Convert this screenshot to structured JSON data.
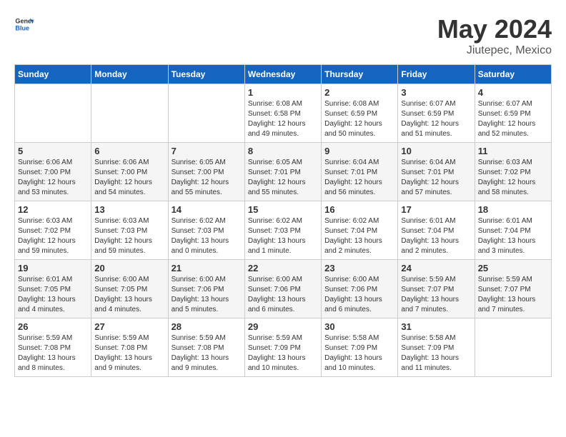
{
  "header": {
    "logo_general": "General",
    "logo_blue": "Blue",
    "title": "May 2024",
    "subtitle": "Jiutepec, Mexico"
  },
  "days_of_week": [
    "Sunday",
    "Monday",
    "Tuesday",
    "Wednesday",
    "Thursday",
    "Friday",
    "Saturday"
  ],
  "weeks": [
    [
      {
        "day": "",
        "info": ""
      },
      {
        "day": "",
        "info": ""
      },
      {
        "day": "",
        "info": ""
      },
      {
        "day": "1",
        "info": "Sunrise: 6:08 AM\nSunset: 6:58 PM\nDaylight: 12 hours\nand 49 minutes."
      },
      {
        "day": "2",
        "info": "Sunrise: 6:08 AM\nSunset: 6:59 PM\nDaylight: 12 hours\nand 50 minutes."
      },
      {
        "day": "3",
        "info": "Sunrise: 6:07 AM\nSunset: 6:59 PM\nDaylight: 12 hours\nand 51 minutes."
      },
      {
        "day": "4",
        "info": "Sunrise: 6:07 AM\nSunset: 6:59 PM\nDaylight: 12 hours\nand 52 minutes."
      }
    ],
    [
      {
        "day": "5",
        "info": "Sunrise: 6:06 AM\nSunset: 7:00 PM\nDaylight: 12 hours\nand 53 minutes."
      },
      {
        "day": "6",
        "info": "Sunrise: 6:06 AM\nSunset: 7:00 PM\nDaylight: 12 hours\nand 54 minutes."
      },
      {
        "day": "7",
        "info": "Sunrise: 6:05 AM\nSunset: 7:00 PM\nDaylight: 12 hours\nand 55 minutes."
      },
      {
        "day": "8",
        "info": "Sunrise: 6:05 AM\nSunset: 7:01 PM\nDaylight: 12 hours\nand 55 minutes."
      },
      {
        "day": "9",
        "info": "Sunrise: 6:04 AM\nSunset: 7:01 PM\nDaylight: 12 hours\nand 56 minutes."
      },
      {
        "day": "10",
        "info": "Sunrise: 6:04 AM\nSunset: 7:01 PM\nDaylight: 12 hours\nand 57 minutes."
      },
      {
        "day": "11",
        "info": "Sunrise: 6:03 AM\nSunset: 7:02 PM\nDaylight: 12 hours\nand 58 minutes."
      }
    ],
    [
      {
        "day": "12",
        "info": "Sunrise: 6:03 AM\nSunset: 7:02 PM\nDaylight: 12 hours\nand 59 minutes."
      },
      {
        "day": "13",
        "info": "Sunrise: 6:03 AM\nSunset: 7:03 PM\nDaylight: 12 hours\nand 59 minutes."
      },
      {
        "day": "14",
        "info": "Sunrise: 6:02 AM\nSunset: 7:03 PM\nDaylight: 13 hours\nand 0 minutes."
      },
      {
        "day": "15",
        "info": "Sunrise: 6:02 AM\nSunset: 7:03 PM\nDaylight: 13 hours\nand 1 minute."
      },
      {
        "day": "16",
        "info": "Sunrise: 6:02 AM\nSunset: 7:04 PM\nDaylight: 13 hours\nand 2 minutes."
      },
      {
        "day": "17",
        "info": "Sunrise: 6:01 AM\nSunset: 7:04 PM\nDaylight: 13 hours\nand 2 minutes."
      },
      {
        "day": "18",
        "info": "Sunrise: 6:01 AM\nSunset: 7:04 PM\nDaylight: 13 hours\nand 3 minutes."
      }
    ],
    [
      {
        "day": "19",
        "info": "Sunrise: 6:01 AM\nSunset: 7:05 PM\nDaylight: 13 hours\nand 4 minutes."
      },
      {
        "day": "20",
        "info": "Sunrise: 6:00 AM\nSunset: 7:05 PM\nDaylight: 13 hours\nand 4 minutes."
      },
      {
        "day": "21",
        "info": "Sunrise: 6:00 AM\nSunset: 7:06 PM\nDaylight: 13 hours\nand 5 minutes."
      },
      {
        "day": "22",
        "info": "Sunrise: 6:00 AM\nSunset: 7:06 PM\nDaylight: 13 hours\nand 6 minutes."
      },
      {
        "day": "23",
        "info": "Sunrise: 6:00 AM\nSunset: 7:06 PM\nDaylight: 13 hours\nand 6 minutes."
      },
      {
        "day": "24",
        "info": "Sunrise: 5:59 AM\nSunset: 7:07 PM\nDaylight: 13 hours\nand 7 minutes."
      },
      {
        "day": "25",
        "info": "Sunrise: 5:59 AM\nSunset: 7:07 PM\nDaylight: 13 hours\nand 7 minutes."
      }
    ],
    [
      {
        "day": "26",
        "info": "Sunrise: 5:59 AM\nSunset: 7:08 PM\nDaylight: 13 hours\nand 8 minutes."
      },
      {
        "day": "27",
        "info": "Sunrise: 5:59 AM\nSunset: 7:08 PM\nDaylight: 13 hours\nand 9 minutes."
      },
      {
        "day": "28",
        "info": "Sunrise: 5:59 AM\nSunset: 7:08 PM\nDaylight: 13 hours\nand 9 minutes."
      },
      {
        "day": "29",
        "info": "Sunrise: 5:59 AM\nSunset: 7:09 PM\nDaylight: 13 hours\nand 10 minutes."
      },
      {
        "day": "30",
        "info": "Sunrise: 5:58 AM\nSunset: 7:09 PM\nDaylight: 13 hours\nand 10 minutes."
      },
      {
        "day": "31",
        "info": "Sunrise: 5:58 AM\nSunset: 7:09 PM\nDaylight: 13 hours\nand 11 minutes."
      },
      {
        "day": "",
        "info": ""
      }
    ]
  ]
}
